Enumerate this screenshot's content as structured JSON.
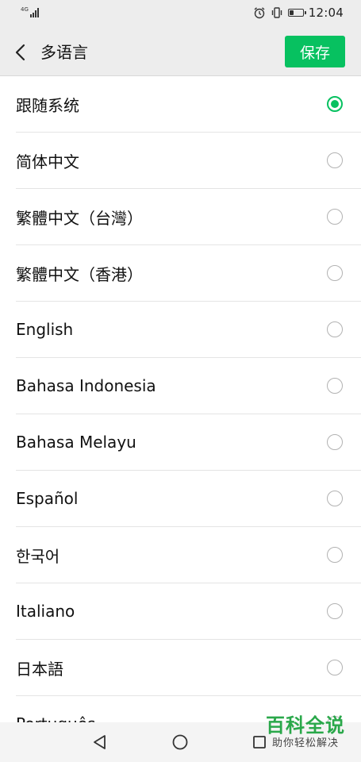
{
  "status_bar": {
    "network": "4G",
    "time": "12:04",
    "battery_level": 0.3
  },
  "header": {
    "title": "多语言",
    "save_label": "保存"
  },
  "languages": [
    {
      "label": "跟随系统",
      "selected": true
    },
    {
      "label": "简体中文",
      "selected": false
    },
    {
      "label": "繁體中文（台灣）",
      "selected": false
    },
    {
      "label": "繁體中文（香港）",
      "selected": false
    },
    {
      "label": "English",
      "selected": false
    },
    {
      "label": "Bahasa Indonesia",
      "selected": false
    },
    {
      "label": "Bahasa Melayu",
      "selected": false
    },
    {
      "label": "Español",
      "selected": false
    },
    {
      "label": "한국어",
      "selected": false
    },
    {
      "label": "Italiano",
      "selected": false
    },
    {
      "label": "日本語",
      "selected": false
    },
    {
      "label": "Português",
      "selected": false
    }
  ],
  "watermark": {
    "main": "百科全说",
    "sub": "助你轻松解决"
  },
  "colors": {
    "accent": "#07c160",
    "header_bg": "#ededed"
  }
}
